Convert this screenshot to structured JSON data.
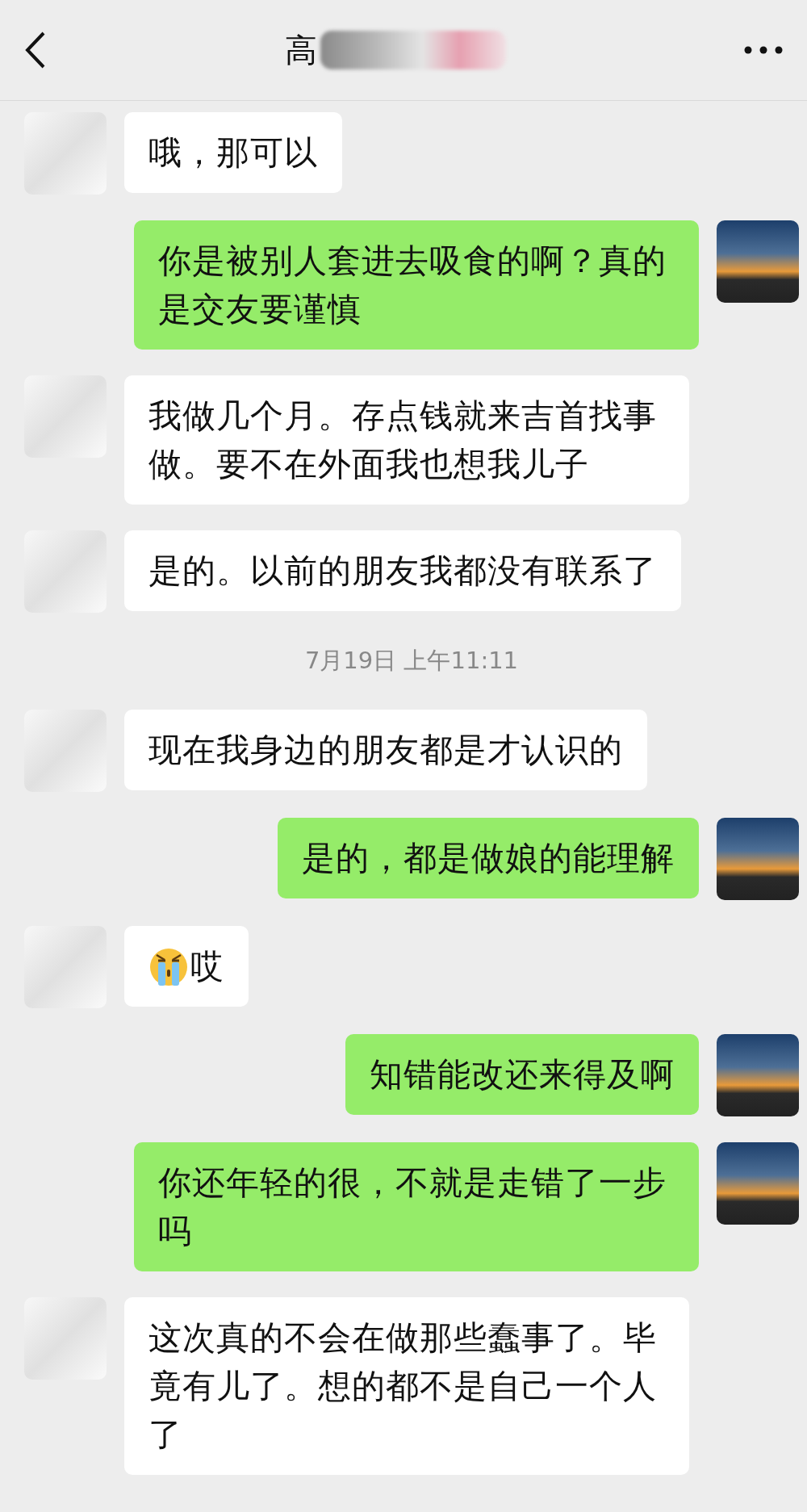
{
  "header": {
    "title": "高"
  },
  "messages": [
    {
      "kind": "text",
      "outgoing": false,
      "text": "哦，那可以"
    },
    {
      "kind": "text",
      "outgoing": true,
      "text": "你是被别人套进去吸食的啊？真的是交友要谨慎"
    },
    {
      "kind": "text",
      "outgoing": false,
      "text": "我做几个月。存点钱就来吉首找事做。要不在外面我也想我儿子"
    },
    {
      "kind": "text",
      "outgoing": false,
      "text": "是的。以前的朋友我都没有联系了"
    },
    {
      "kind": "time",
      "text": "7月19日 上午11:11"
    },
    {
      "kind": "text",
      "outgoing": false,
      "text": "现在我身边的朋友都是才认识的"
    },
    {
      "kind": "text",
      "outgoing": true,
      "text": "是的，都是做娘的能理解"
    },
    {
      "kind": "emoji_text",
      "outgoing": false,
      "text": "哎"
    },
    {
      "kind": "text",
      "outgoing": true,
      "text": "知错能改还来得及啊"
    },
    {
      "kind": "text",
      "outgoing": true,
      "text": "你还年轻的很，不就是走错了一步吗"
    },
    {
      "kind": "text",
      "outgoing": false,
      "text": "这次真的不会在做那些蠢事了。毕竟有儿了。想的都不是自己一个人了"
    }
  ]
}
